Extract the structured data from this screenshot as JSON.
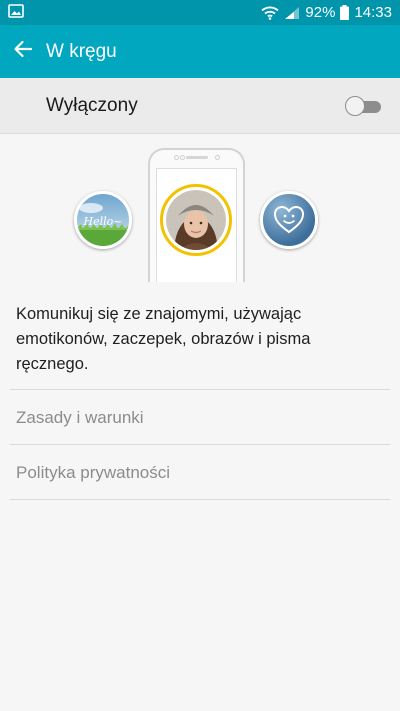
{
  "status_bar": {
    "battery": "92%",
    "time": "14:33",
    "icons": [
      "image-notification-icon",
      "wifi-icon",
      "signal-icon",
      "battery-icon"
    ]
  },
  "app_bar": {
    "title": "W kręgu",
    "back_icon": "arrow-left-icon",
    "color": "#00a7be",
    "status_color": "#0095ab"
  },
  "switch_row": {
    "label": "Wyłączony",
    "enabled": false
  },
  "illustration": {
    "bubble_left_text": "Hello~",
    "icons": [
      "hello-image",
      "profile-photo",
      "heart-smile-icon"
    ],
    "accent_ring_color": "#f2c200"
  },
  "description": "Komunikuj się ze znajomymi, używając emotikonów, zaczepek, obrazów i pisma ręcznego.",
  "links": [
    {
      "label": "Zasady i warunki"
    },
    {
      "label": "Polityka prywatności"
    }
  ]
}
